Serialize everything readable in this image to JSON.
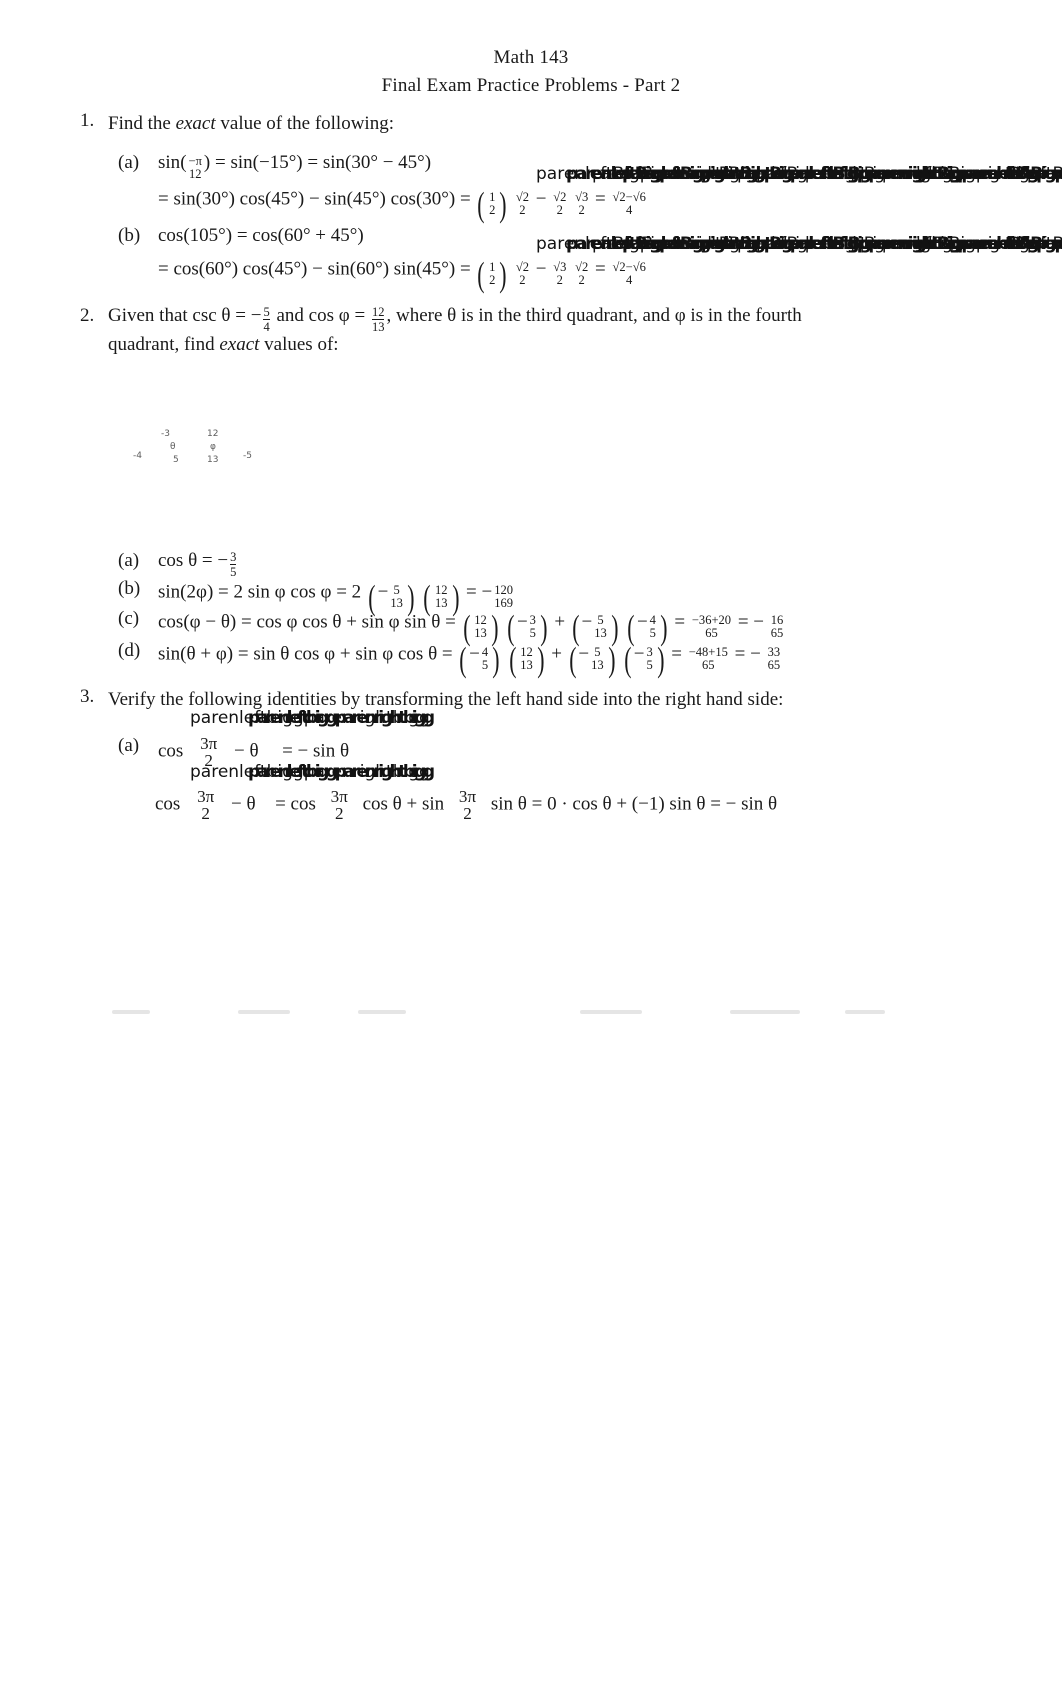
{
  "header": {
    "title": "Math 143",
    "subtitle": "Final Exam Practice Problems - Part 2"
  },
  "problems": [
    {
      "number": "1.",
      "stem_pre": "Find the ",
      "stem_em": "exact",
      "stem_post": " value of the following:",
      "parts": [
        {
          "label": "(a)",
          "line1": "sin(  ) = sin(−15°) = sin(30° − 45°)",
          "line1_frac_num": "−π",
          "line1_frac_den": "12",
          "line2_lhs": "= sin(30°) cos(45°) − sin(45°) cos(30°) =",
          "line2_f1_num": "1",
          "line2_f1_den": "2",
          "line2_f2_num": "√2",
          "line2_f2_den": "2",
          "line2_minus": "−",
          "line2_f3_num": "√2",
          "line2_f3_den": "2",
          "line2_f4_num": "√3",
          "line2_f4_den": "2",
          "line2_eq": "=",
          "line2_f5_num": "√2−√6",
          "line2_f5_den": "4",
          "artifact": "parenleftBigparenrightBigparenleftBigparenrightBigparenleftBigparenrightBigparenleftBig"
        },
        {
          "label": "(b)",
          "line1": "cos(105°) = cos(60° + 45°)",
          "line2_lhs": "= cos(60°) cos(45°) − sin(60°) sin(45°) =",
          "line2_f1_num": "1",
          "line2_f1_den": "2",
          "line2_f2_num": "√2",
          "line2_f2_den": "2",
          "line2_minus": "−",
          "line2_f3_num": "√3",
          "line2_f3_den": "2",
          "line2_f4_num": "√2",
          "line2_f4_den": "2",
          "line2_eq": "=",
          "line2_f5_num": "√2−√6",
          "line2_f5_den": "4",
          "artifact": "parenleftBigparenrightBigparenleftBigparenrightBigparenleftBigparenrightBigparenleftBig"
        }
      ]
    },
    {
      "number": "2.",
      "stem_a": "Given that csc θ = −",
      "stem_csc_num": "5",
      "stem_csc_den": "4",
      "stem_b": " and cos φ = ",
      "stem_cos_num": "12",
      "stem_cos_den": "13",
      "stem_c": ", where θ is in the third quadrant, and φ is in the fourth",
      "stem_d": "quadrant, find ",
      "stem_d_em": "exact",
      "stem_d_post": " values of:",
      "diagram": {
        "left": {
          "adjacent": "-3",
          "angle": "θ",
          "hypotenuse": "5",
          "opposite": "-4"
        },
        "right": {
          "adjacent": "12",
          "angle": "φ",
          "hypotenuse": "13",
          "opposite": "-5"
        }
      },
      "parts": [
        {
          "label": "(a)",
          "expr": "cos θ = −",
          "frac_num": "3",
          "frac_den": "5"
        },
        {
          "label": "(b)",
          "expr": "sin(2φ) = 2 sin φ cos φ = 2",
          "t1_num": "5",
          "t1_den": "13",
          "t1_sign": "−",
          "t2_num": "12",
          "t2_den": "13",
          "t2_sign": "",
          "eq": "= −",
          "res_num": "120",
          "res_den": "169"
        },
        {
          "label": "(c)",
          "expr": "cos(φ − θ) = cos φ cos θ + sin φ sin θ =",
          "t1_num": "12",
          "t1_den": "13",
          "t1_sign": "",
          "t2_num": "3",
          "t2_den": "5",
          "t2_sign": "−",
          "plus": "+",
          "t3_num": "5",
          "t3_den": "13",
          "t3_sign": "−",
          "t4_num": "4",
          "t4_den": "5",
          "t4_sign": "−",
          "eq": "=",
          "mid_num": "−36+20",
          "mid_den": "65",
          "eq2": "= −",
          "res_num": "16",
          "res_den": "65"
        },
        {
          "label": "(d)",
          "expr": "sin(θ + φ) = sin θ cos φ + sin φ cos θ =",
          "t1_num": "4",
          "t1_den": "5",
          "t1_sign": "−",
          "t2_num": "12",
          "t2_den": "13",
          "t2_sign": "",
          "plus": "+",
          "t3_num": "5",
          "t3_den": "13",
          "t3_sign": "−",
          "t4_num": "3",
          "t4_den": "5",
          "t4_sign": "−",
          "eq": "=",
          "mid_num": "−48+15",
          "mid_den": "65",
          "eq2": "= −",
          "res_num": "33",
          "res_den": "65"
        }
      ]
    },
    {
      "number": "3.",
      "stem": "Verify the following identities by transforming the left hand side into the right hand side:",
      "artifact_top": "parenleftbiggparenrightbigg",
      "artifact_second": "parenleftbiggparenrightbigg",
      "parts": [
        {
          "label": "(a)",
          "l1_cos": "cos",
          "l1_num": "3π",
          "l1_den": "2",
          "l1_mid": "− θ",
          "l1_rhs": "= − sin θ",
          "l2_cos": "cos",
          "l2_num": "3π",
          "l2_den": "2",
          "l2_mid": "− θ",
          "l2_eq": "= cos",
          "l2_num2": "3π",
          "l2_den2": "2",
          "l2_mid2": "cos θ + sin",
          "l2_num3": "3π",
          "l2_den3": "2",
          "l2_tail": "sin θ = 0 · cos θ + (−1) sin θ = − sin θ"
        }
      ]
    }
  ],
  "colors": {
    "text": "#1a1a1a",
    "diagram_label": "#5d5d5d",
    "page_background": "#ffffff"
  }
}
